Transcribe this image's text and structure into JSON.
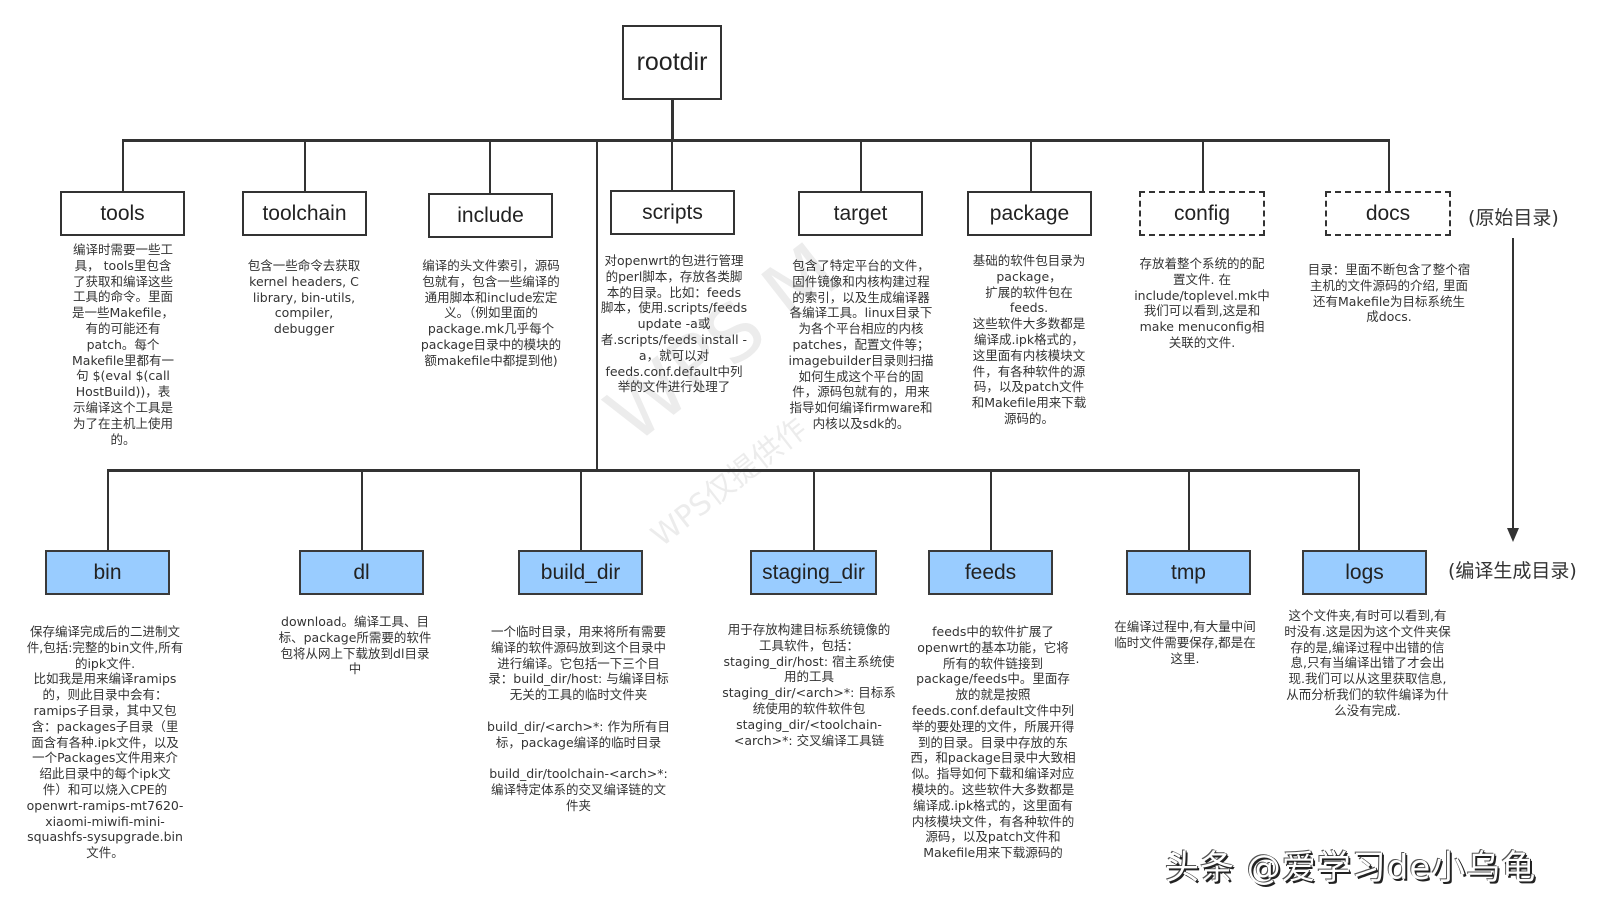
{
  "root": {
    "label": "rootdir"
  },
  "source_dirs": [
    {
      "label": "tools",
      "style": "solid",
      "desc": "编译时需要一些工\n具， tools里包含\n了获取和编译这些\n工具的命令。里面\n是一些Makefile，\n有的可能还有\npatch。每个\nMakefile里都有一\n句 $(eval $(call\nHostBuild))，表\n示编译这个工具是\n为了在主机上使用\n的。"
    },
    {
      "label": "toolchain",
      "style": "solid",
      "desc": "包含一些命令去获取\nkernel headers, C\nlibrary, bin-utils,\ncompiler,\ndebugger"
    },
    {
      "label": "include",
      "style": "solid",
      "desc": "编译的头文件索引，源码\n包就有，包含一些编译的\n通用脚本和include宏定\n义。（例如里面的\npackage.mk几乎每个\npackage目录中的模块的\n额makefile中都提到他)"
    },
    {
      "label": "scripts",
      "style": "solid",
      "desc": "对openwrt的包进行管理\n的perl脚本，存放各类脚\n本的目录。比如：feeds\n脚本，使用.scripts/feeds\nupdate -a或\n者.scripts/feeds install -\na，就可以对\nfeeds.conf.default中列\n举的文件进行处理了"
    },
    {
      "label": "target",
      "style": "solid",
      "desc": "包含了特定平台的文件，\n固件镜像和内核构建过程\n的索引，以及生成编译器\n各编译工具。linux目录下\n为各个平台相应的内核\npatches，配置文件等；\nimagebuilder目录则扫描\n如何生成这个平台的固\n件，源码包就有的，用来\n指导如何编译firmware和\n内核以及sdk的。"
    },
    {
      "label": "package",
      "style": "solid",
      "desc": "基础的软件包目录为\npackage，\n扩展的软件包在\nfeeds.\n这些软件大多数都是\n编译成.ipk格式的，\n这里面有内核模块文\n件，有各种软件的源\n码，以及patch文件\n和Makefile用来下载\n源码的。"
    },
    {
      "label": "config",
      "style": "dashed",
      "desc": "存放着整个系统的的配\n置文件. 在\ninclude/toplevel.mk中\n我们可以看到,这是和\nmake menuconfig相\n关联的文件."
    },
    {
      "label": "docs",
      "style": "dashed",
      "desc": "目录：里面不断包含了整个宿\n主机的文件源码的介绍, 里面\n还有Makefile为目标系统生\n成docs."
    }
  ],
  "generated_dirs": [
    {
      "label": "bin",
      "desc": "保存编译完成后的二进制文\n件,包括:完整的bin文件,所有\n的ipk文件.\n比如我是用来编译ramips\n的，则此目录中会有：\nramips子目录，其中又包\n含：packages子目录（里\n面含有各种.ipk文件，以及\n一个Packages文件用来介\n绍此目录中的每个ipk文\n件）和可以烧入CPE的\nopenwrt-ramips-mt7620-\nxiaomi-miwifi-mini-\nsquashfs-sysupgrade.bin\n文件。"
    },
    {
      "label": "dl",
      "desc": "download。编译工具、目\n标、package所需要的软件\n包将从网上下载放到dl目录\n中"
    },
    {
      "label": "build_dir",
      "desc": "一个临时目录，用来将所有需要\n编译的软件源码放到这个目录中\n进行编译。它包括一下三个目\n录：build_dir/host: 与编译目标\n无关的工具的临时文件夹\n\nbuild_dir/<arch>*: 作为所有目\n标，package编译的临时目录\n\nbuild_dir/toolchain-<arch>*:\n编译特定体系的交叉编译链的文\n件夹"
    },
    {
      "label": "staging_dir",
      "desc": "用于存放构建目标系统镜像的\n工具软件，包括：\nstaging_dir/host: 宿主系统使\n用的工具\nstaging_dir/<arch>*: 目标系\n统使用的软件软件包\nstaging_dir/<toolchain-\n<arch>*: 交叉编译工具链"
    },
    {
      "label": "feeds",
      "desc": "feeds中的软件扩展了\nopenwrt的基本功能，它将\n所有的软件链接到\npackage/feeds中。里面存\n放的就是按照\nfeeds.conf.default文件中列\n举的要处理的文件，所展开得\n到的目录。目录中存放的东\n西，和package目录中大致相\n似。指导如何下载和编译对应\n模块的。这些软件大多数都是\n编译成.ipk格式的，这里面有\n内核模块文件，有各种软件的\n源码，以及patch文件和\nMakefile用来下载源码的"
    },
    {
      "label": "tmp",
      "desc": "在编译过程中,有大量中间\n临时文件需要保存,都是在\n这里."
    },
    {
      "label": "logs",
      "desc": "这个文件夹,有时可以看到,有\n时没有.这是因为这个文件夹保\n存的是,编译过程中出错的信\n息,只有当编译出错了才会出\n现.我们可以从这里获取信息,\n从而分析我们的软件编译为什\n么没有完成."
    }
  ],
  "legend": {
    "source_label": "(原始目录)",
    "generated_label": "(编译生成目录)"
  },
  "colors": {
    "generated_box_fill": "#99ccff",
    "line": "#333333"
  },
  "watermark": {
    "main": "WPS M",
    "sub": "WPS仅提供作"
  },
  "credit": "头条 @爱学习de小乌龟"
}
